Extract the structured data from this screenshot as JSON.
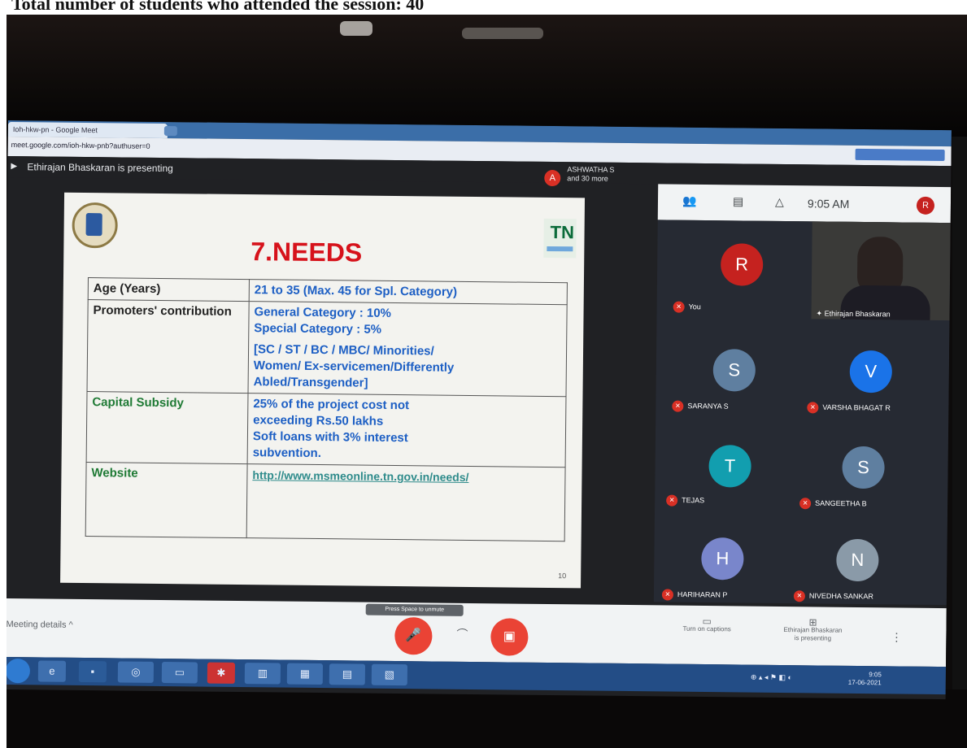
{
  "scan_caption": "Total number  of students who attended the session: 40",
  "browser": {
    "tab_title": "Ioh-hkw-pn - Google Meet",
    "url": "meet.google.com/ioh-hkw-pnb?authuser=0"
  },
  "meet": {
    "presenting_text": "Ethirajan Bhaskaran is presenting",
    "attendee_chip": {
      "initial": "A",
      "line1": "ASHWATHA S",
      "line2": "and 30 more"
    },
    "status": {
      "time": "9:05 AM",
      "self_initial": "R",
      "self_label": "You"
    },
    "self_video_name": "Ethirajan Bhaskaran",
    "participants": [
      {
        "initial": "R",
        "name": "You",
        "color": "#c5221f"
      },
      {
        "initial": "S",
        "name": "SARANYA S",
        "color": "#5f7fa0"
      },
      {
        "initial": "V",
        "name": "VARSHA BHAGAT R",
        "color": "#1a73e8"
      },
      {
        "initial": "T",
        "name": "TEJAS",
        "color": "#129eaf"
      },
      {
        "initial": "S",
        "name": "SANGEETHA B",
        "color": "#5f7fa0"
      },
      {
        "initial": "H",
        "name": "HARIHARAN P",
        "color": "#7986cb"
      },
      {
        "initial": "N",
        "name": "NIVEDHA SANKAR",
        "color": "#8a9aa8"
      }
    ],
    "bottom": {
      "meeting_details": "Meeting details",
      "chevron": "^",
      "hint": "Press Space to unmute",
      "mic_icon": "mic-off-icon",
      "end_icon": "call-end-icon",
      "captions_label": "Turn on captions",
      "present_label1": "Ethirajan Bhaskaran",
      "present_label2": "is presenting",
      "more_label": "⋮"
    }
  },
  "slide": {
    "title": "7.NEEDS",
    "logo_text": "TN",
    "rows": [
      {
        "key": "Age (Years)",
        "value": [
          "21  to 35 (Max. 45 for Spl. Category)"
        ]
      },
      {
        "key": "Promoters' contribution",
        "value": [
          "General Category :   10%",
          "Special Category :      5%",
          "[SC / ST / BC / MBC/ Minorities/",
          "Women/ Ex-servicemen/Differently",
          "Abled/Transgender]"
        ]
      },
      {
        "key": "Capital Subsidy",
        "value": [
          "25% of the project cost not",
          "exceeding Rs.50 lakhs",
          "Soft loans with 3% interest",
          "subvention."
        ]
      },
      {
        "key": "Website",
        "value": [
          "http://www.msmeonline.tn.gov.in/needs/"
        ]
      }
    ],
    "page_number": "10"
  },
  "taskbar": {
    "tray_text": "⊕ ▴ ◂ ⚑ ◧ ◐",
    "clock_time": "9:05",
    "clock_date": "17-06-2021"
  }
}
